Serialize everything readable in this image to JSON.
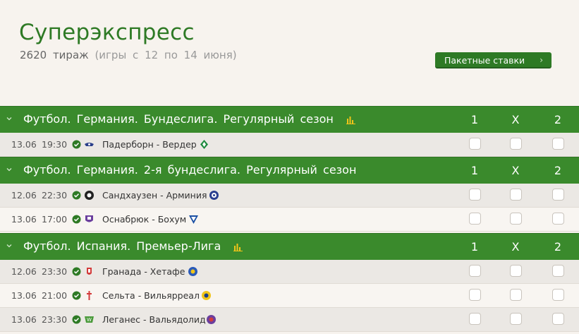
{
  "header": {
    "title": "Суперэкспресс",
    "draw": "2620 тираж",
    "draw_dates": "(игры с 12 по 14 июня)",
    "packet_button": "Пакетные ставки"
  },
  "columns": [
    "1",
    "X",
    "2"
  ],
  "leagues": [
    {
      "name": "Футбол. Германия. Бундеслига. Регулярный сезон",
      "has_stats": true,
      "matches": [
        {
          "date": "13.06",
          "time": "19:30",
          "teams": "Падерборн - Вердер"
        }
      ]
    },
    {
      "name": "Футбол. Германия. 2-я бундеслига. Регулярный сезон",
      "has_stats": false,
      "matches": [
        {
          "date": "12.06",
          "time": "22:30",
          "teams": "Сандхаузен - Арминия"
        },
        {
          "date": "13.06",
          "time": "17:00",
          "teams": "Оснабрюк - Бохум"
        }
      ]
    },
    {
      "name": "Футбол. Испания. Премьер-Лига",
      "has_stats": true,
      "matches": [
        {
          "date": "12.06",
          "time": "23:30",
          "teams": "Гранада - Хетафе"
        },
        {
          "date": "13.06",
          "time": "21:00",
          "teams": "Сельта - Вильярреал"
        },
        {
          "date": "13.06",
          "time": "23:30",
          "teams": "Леганес - Вальядолид"
        }
      ]
    }
  ],
  "colors": {
    "brand_green": "#2e7a25",
    "league_bar": "#3a8a2c",
    "stats_icon": "#f0c419"
  }
}
